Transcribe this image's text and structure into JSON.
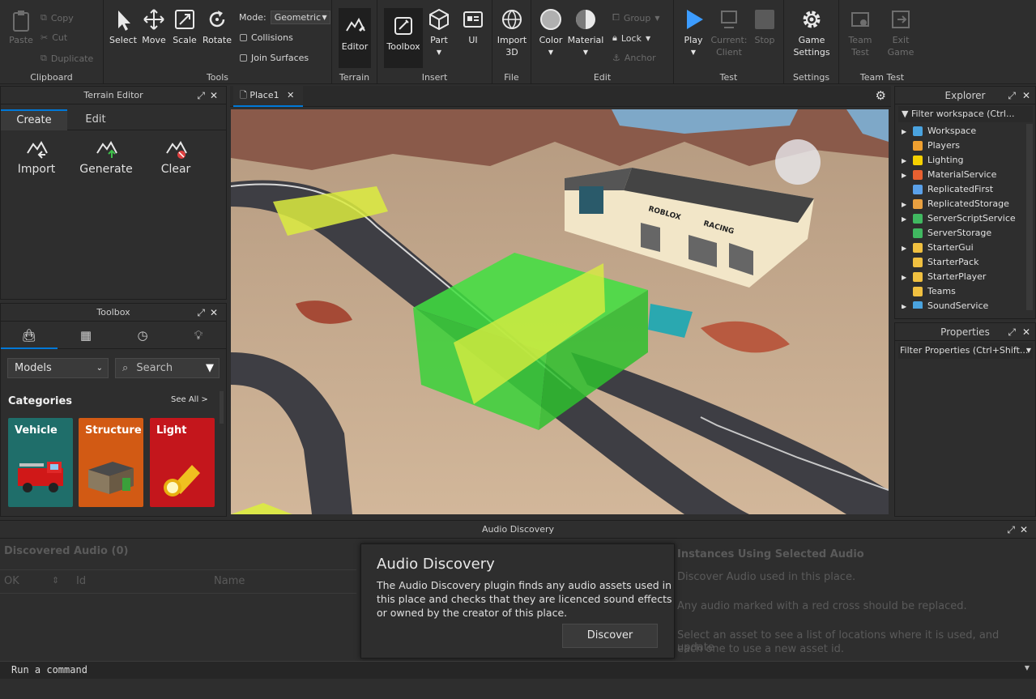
{
  "ribbon": {
    "clipboard": {
      "paste": "Paste",
      "copy": "Copy",
      "cut": "Cut",
      "duplicate": "Duplicate",
      "label": "Clipboard"
    },
    "tools": {
      "select": "Select",
      "move": "Move",
      "scale": "Scale",
      "rotate": "Rotate",
      "mode_label": "Mode:",
      "mode_value": "Geometric",
      "collisions": "Collisions",
      "join_surfaces": "Join Surfaces",
      "label": "Tools"
    },
    "terrain": {
      "editor": "Editor",
      "label": "Terrain"
    },
    "insert": {
      "toolbox": "Toolbox",
      "part": "Part",
      "ui": "UI",
      "label": "Insert"
    },
    "file": {
      "import3d_line1": "Import",
      "import3d_line2": "3D",
      "label": "File"
    },
    "edit": {
      "color": "Color",
      "material": "Material",
      "group": "Group",
      "lock": "Lock",
      "anchor": "Anchor",
      "label": "Edit"
    },
    "test": {
      "play": "Play",
      "current_line1": "Current:",
      "current_line2": "Client",
      "stop": "Stop",
      "label": "Test"
    },
    "settings": {
      "game_line1": "Game",
      "game_line2": "Settings",
      "label": "Settings"
    },
    "team_test": {
      "team_line1": "Team",
      "team_line2": "Test",
      "exit_line1": "Exit",
      "exit_line2": "Game",
      "label": "Team Test"
    }
  },
  "terrain_editor": {
    "title": "Terrain Editor",
    "tabs": [
      "Create",
      "Edit"
    ],
    "tools": [
      "Import",
      "Generate",
      "Clear"
    ]
  },
  "toolbox": {
    "title": "Toolbox",
    "dropdown": "Models",
    "search_placeholder": "Search",
    "categories_label": "Categories",
    "see_all": "See All >",
    "cards": [
      {
        "label": "Vehicle",
        "color": "#1f6e6a"
      },
      {
        "label": "Structure",
        "color": "#d25a14"
      },
      {
        "label": "Light",
        "color": "#c4161c"
      }
    ]
  },
  "viewport": {
    "tab": "Place1"
  },
  "explorer": {
    "title": "Explorer",
    "filter": "Filter workspace (Ctrl...",
    "items": [
      {
        "label": "Workspace",
        "expand": true,
        "icon": "globe-icon",
        "color": "#4aa3df"
      },
      {
        "label": "Players",
        "expand": false,
        "icon": "players-icon",
        "color": "#f0a030"
      },
      {
        "label": "Lighting",
        "expand": true,
        "icon": "lightbulb-icon",
        "color": "#f5d000"
      },
      {
        "label": "MaterialService",
        "expand": true,
        "icon": "material-icon",
        "color": "#e86030"
      },
      {
        "label": "ReplicatedFirst",
        "expand": false,
        "icon": "replicated-first-icon",
        "color": "#5aa0e8"
      },
      {
        "label": "ReplicatedStorage",
        "expand": true,
        "icon": "replicated-storage-icon",
        "color": "#e8a040"
      },
      {
        "label": "ServerScriptService",
        "expand": true,
        "icon": "server-script-icon",
        "color": "#40b860"
      },
      {
        "label": "ServerStorage",
        "expand": false,
        "icon": "server-storage-icon",
        "color": "#40b860"
      },
      {
        "label": "StarterGui",
        "expand": true,
        "icon": "starter-gui-icon",
        "color": "#f0c040"
      },
      {
        "label": "StarterPack",
        "expand": false,
        "icon": "starter-pack-icon",
        "color": "#f0c040"
      },
      {
        "label": "StarterPlayer",
        "expand": true,
        "icon": "starter-player-icon",
        "color": "#f0c040"
      },
      {
        "label": "Teams",
        "expand": false,
        "icon": "teams-icon",
        "color": "#f0c040"
      },
      {
        "label": "SoundService",
        "expand": true,
        "icon": "sound-icon",
        "color": "#4aa3df"
      }
    ]
  },
  "properties": {
    "title": "Properties",
    "filter": "Filter Properties (Ctrl+Shift..."
  },
  "audio_discovery": {
    "title": "Audio Discovery",
    "discovered": "Discovered Audio (0)",
    "col_ok": "OK",
    "col_id": "Id",
    "col_name": "Name",
    "instances_title": "Instances Using Selected Audio",
    "instances_line1": "Discover Audio used in this place.",
    "instances_line2": "Any audio marked with a red cross should be replaced.",
    "instances_line3": "Select an asset to see a list of locations where it is used, and update",
    "instances_line4": "each one to use a new asset id.",
    "dialog_title": "Audio Discovery",
    "dialog_text_1": "The Audio Discovery plugin finds any audio assets used in",
    "dialog_text_2": "this place and checks that they are licenced sound effects",
    "dialog_text_3": "or owned by the creator of this place.",
    "discover_button": "Discover"
  },
  "command_bar": {
    "placeholder": "Run a command"
  },
  "scene_text": {
    "sign1": "ROBLOX",
    "sign2": "RACING"
  },
  "colors": {
    "accent": "#0078d7",
    "play_blue": "#3c9cff",
    "panel_bg": "#2e2e2e"
  }
}
